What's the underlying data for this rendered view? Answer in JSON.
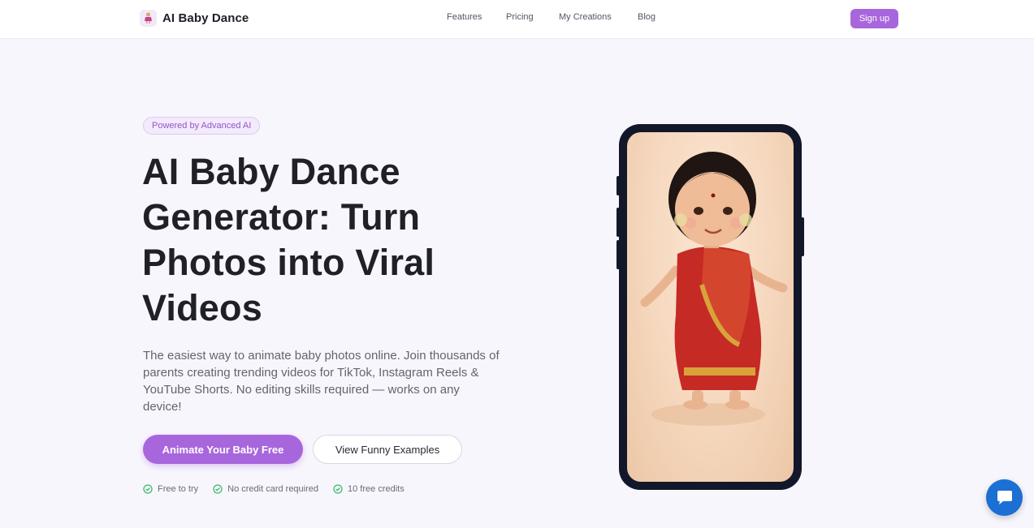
{
  "nav": {
    "brand": "AI Baby Dance",
    "links": [
      "Features",
      "Pricing",
      "My Creations",
      "Blog"
    ],
    "signup": "Sign up"
  },
  "hero": {
    "badge": "Powered by Advanced AI",
    "title": "AI Baby Dance Generator: Turn Photos into Viral Videos",
    "subtitle": "The easiest way to animate baby photos online. Join thousands of parents creating trending videos for TikTok, Instagram Reels & YouTube Shorts. No editing skills required — works on any device!",
    "cta_primary": "Animate Your Baby Free",
    "cta_secondary": "View Funny Examples",
    "features": [
      "Free to try",
      "No credit card required",
      "10 free credits"
    ]
  },
  "icons": {
    "logo": "baby-dance-logo-icon",
    "check": "check-circle-icon",
    "chat": "chat-bubble-icon"
  },
  "colors": {
    "accent": "#a866dc",
    "check": "#3dbb6a",
    "chat": "#1c6fd3",
    "phone": "#121829"
  }
}
